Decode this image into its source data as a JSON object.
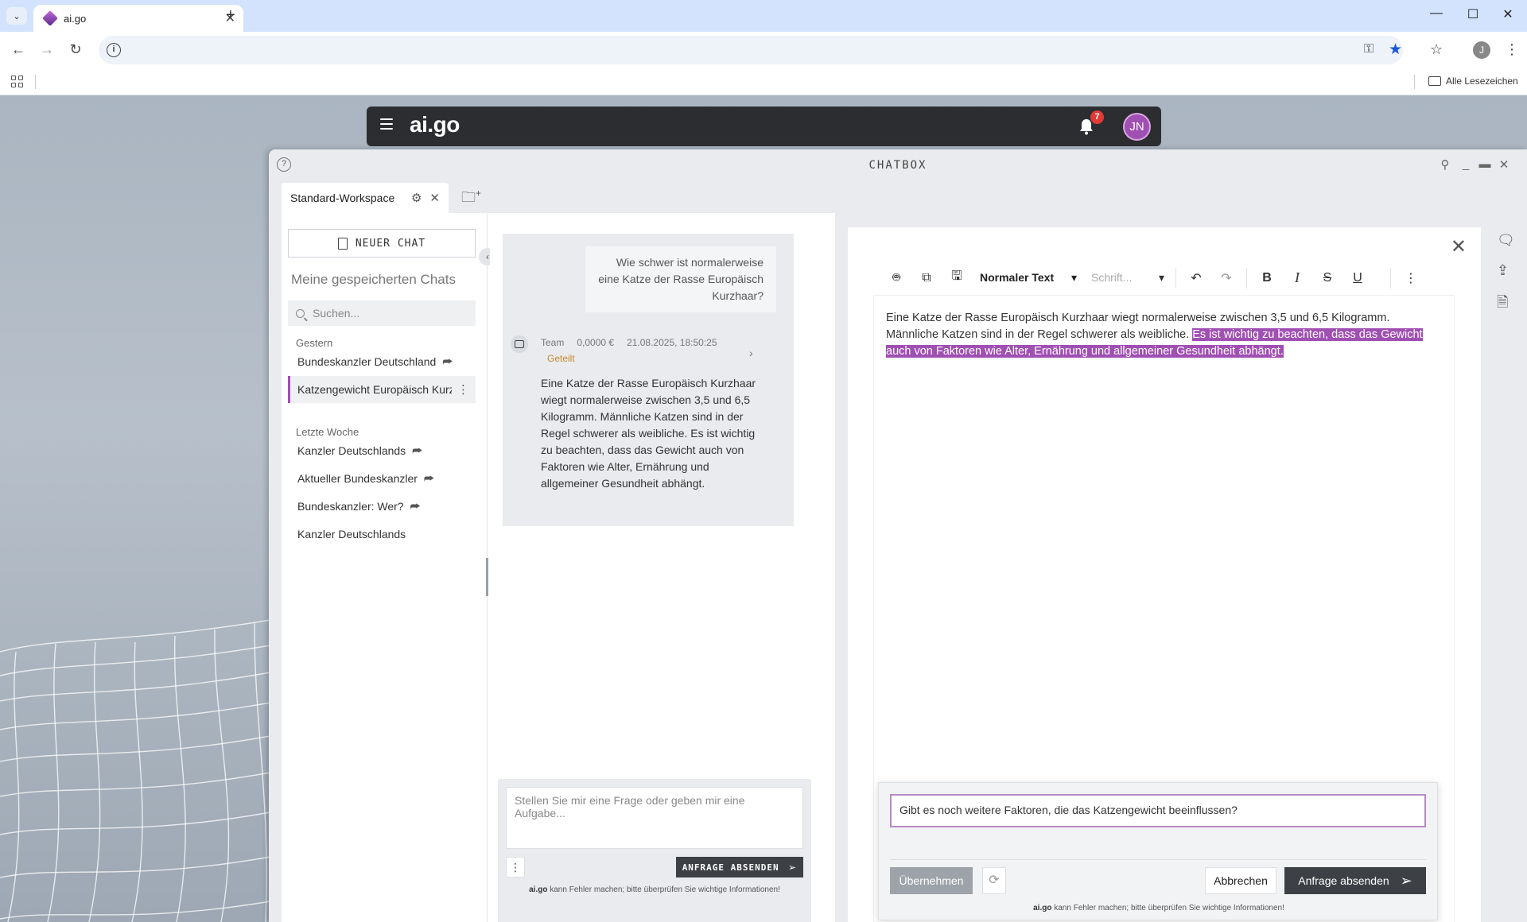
{
  "browser": {
    "tab_title": "ai.go",
    "bookmarks_all": "Alle Lesezeichen",
    "profile_initial": "J"
  },
  "appbar": {
    "brand": "ai.go",
    "notifications_count": "7",
    "avatar_initials": "JN"
  },
  "chatbox": {
    "title": "CHATBOX",
    "workspace_tab": "Standard-Workspace"
  },
  "sidebar": {
    "new_chat": "NEUER CHAT",
    "saved_title": "Meine gespeicherten Chats",
    "search_placeholder": "Suchen...",
    "groups": [
      {
        "label": "Gestern",
        "items": [
          {
            "label": "Bundeskanzler Deutschland",
            "shared": true
          },
          {
            "label": "Katzengewicht Europäisch Kurz",
            "active": true
          }
        ]
      },
      {
        "label": "Letzte Woche",
        "items": [
          {
            "label": "Kanzler Deutschlands",
            "shared": true
          },
          {
            "label": "Aktueller Bundeskanzler",
            "shared": true
          },
          {
            "label": "Bundeskanzler: Wer?",
            "shared": true
          },
          {
            "label": "Kanzler Deutschlands",
            "shared": false
          }
        ]
      }
    ]
  },
  "chat": {
    "user_message": "Wie schwer ist normalerweise eine Katze der Rasse Europäisch Kurzhaar?",
    "bot_meta": {
      "team": "Team",
      "cost": "0,0000 €",
      "timestamp": "21.08.2025, 18:50:25",
      "shared": "Geteilt"
    },
    "bot_message": "Eine Katze der Rasse Europäisch Kurzhaar wiegt normalerweise zwischen 3,5 und 6,5 Kilogramm. Männliche Katzen sind in der Regel schwerer als weibliche. Es ist wichtig zu beachten, dass das Gewicht auch von Faktoren wie Alter, Ernährung und allgemeiner Gesundheit abhängt.",
    "input_placeholder": "Stellen Sie mir eine Frage oder geben mir eine Aufgabe...",
    "send_label": "ANFRAGE ABSENDEN",
    "disclaimer_brand": "ai.go",
    "disclaimer_text": " kann Fehler machen; bitte überprüfen Sie wichtige Informationen!"
  },
  "editor": {
    "style_select": "Normaler Text",
    "font_select": "Schrift...",
    "text_plain": "Eine Katze der Rasse Europäisch Kurzhaar wiegt normalerweise zwischen 3,5 und 6,5 Kilogramm. Männliche Katzen sind in der Regel schwerer als weibliche. ",
    "text_highlighted": "Es ist wichtig zu beachten, dass das Gewicht auch von Faktoren wie Alter, Ernährung und allgemeiner Gesundheit abhängt.",
    "prompt_value": "Gibt es noch weitere Faktoren, die das Katzengewicht beeinflussen?",
    "apply_label": "Übernehmen",
    "cancel_label": "Abbrechen",
    "send_label": "Anfrage absenden",
    "disclaimer_brand": "ai.go",
    "disclaimer_text": " kann Fehler machen; bitte überprüfen Sie wichtige Informationen!"
  },
  "colors": {
    "accent": "#a04fb3",
    "dark": "#2b2d31",
    "badge": "#e53935"
  }
}
